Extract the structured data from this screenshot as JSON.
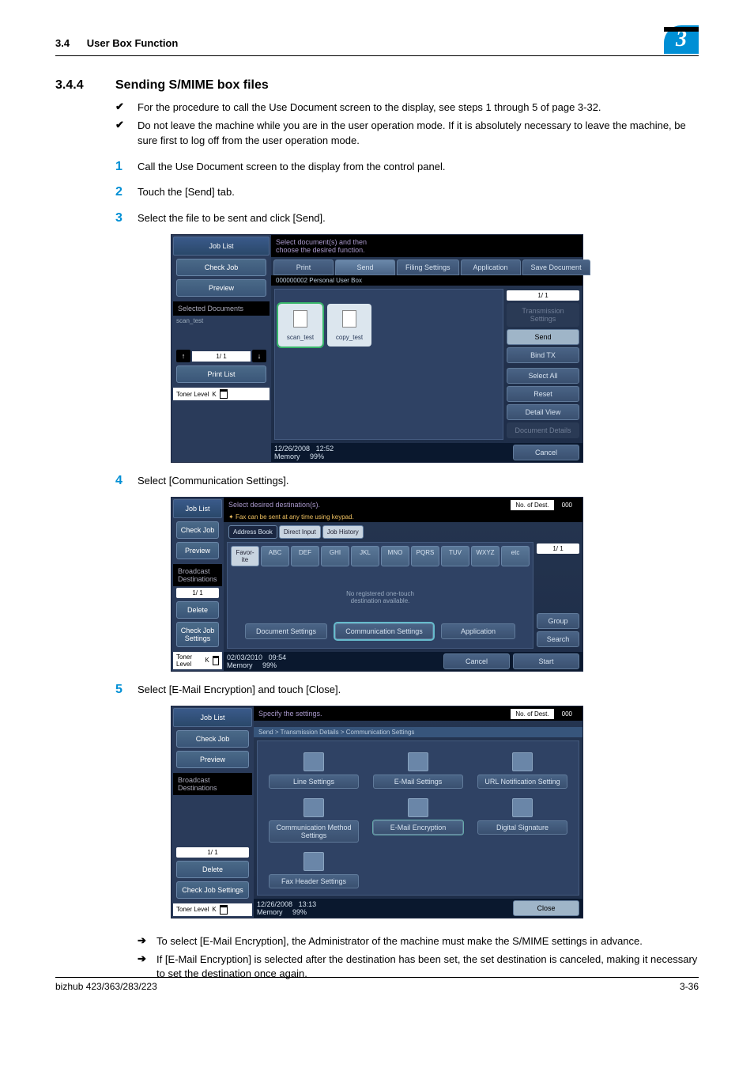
{
  "header": {
    "section": "3.4",
    "title": "User Box Function",
    "badge": "3"
  },
  "heading": {
    "num": "3.4.4",
    "title": "Sending S/MIME box files"
  },
  "bullets": [
    "For the procedure to call the Use Document screen to the display, see steps 1 through 5 of page 3-32.",
    "Do not leave the machine while you are in the user operation mode. If it is absolutely necessary to leave the machine, be sure first to log off from the user operation mode."
  ],
  "steps": {
    "s1": "Call the Use Document screen to the display from the control panel.",
    "s2": "Touch the [Send] tab.",
    "s3": "Select the file to be sent and click [Send].",
    "s4": "Select [Communication Settings].",
    "s5": "Select [E-Mail Encryption] and touch [Close]."
  },
  "arrows": [
    "To select [E-Mail Encryption], the Administrator of the machine must make the S/MIME settings in advance.",
    "If [E-Mail Encryption] is selected after the destination has been set, the set destination is canceled, making it necessary to set the destination once again."
  ],
  "ss_common_left": {
    "job_list": "Job List",
    "check_job": "Check Job",
    "preview": "Preview",
    "broadcast": "Broadcast Destinations",
    "selected_docs": "Selected Documents",
    "scan_test": "scan_test",
    "page": "1/  1",
    "delete": "Delete",
    "check_job_settings": "Check Job Settings",
    "print_list": "Print List",
    "toner": "Toner Level",
    "k": "K"
  },
  "ss1": {
    "instr": "Select document(s) and then\nchoose the desired function.",
    "tabs": {
      "print": "Print",
      "send": "Send",
      "filing": "Filing Settings",
      "application": "Application",
      "save": "Save Document"
    },
    "boxlabel": "000000002  Personal User Box",
    "thumbs": {
      "t1": "scan_test",
      "t2": "copy_test"
    },
    "right": {
      "page": "1/  1",
      "trans": "Transmission Settings",
      "send": "Send",
      "bind": "Bind TX",
      "select": "Select All",
      "reset": "Reset",
      "detail": "Detail View",
      "docdet": "Document Details"
    },
    "cancel": "Cancel",
    "status": {
      "date": "12/26/2008",
      "time": "12:52",
      "mem": "Memory",
      "pct": "99%"
    }
  },
  "ss2": {
    "instr": "Select desired destination(s).",
    "hint": "Fax can be sent at any time using keypad.",
    "chip": {
      "label": "No. of Dest.",
      "val": "000"
    },
    "tabs": {
      "ab": "Address Book",
      "di": "Direct Input",
      "jh": "Job History"
    },
    "keys": {
      "fav": "Favor-ite",
      "abc": "ABC",
      "def": "DEF",
      "ghi": "GHI",
      "jkl": "JKL",
      "mno": "MNO",
      "pqrs": "PQRS",
      "tuv": "TUV",
      "wxyz": "WXYZ",
      "etc": "etc"
    },
    "msg": "No registered one-touch\ndestination available.",
    "right": {
      "page": "1/  1",
      "group": "Group",
      "search": "Search"
    },
    "bottom": {
      "doc": "Document Settings",
      "comm": "Communication Settings",
      "app": "Application",
      "cancel": "Cancel",
      "start": "Start"
    },
    "status": {
      "date": "02/03/2010",
      "time": "09:54",
      "mem": "Memory",
      "pct": "99%"
    }
  },
  "ss3": {
    "instr": "Specify the settings.",
    "chip": {
      "label": "No. of Dest.",
      "val": "000"
    },
    "crumb": "Send > Transmission Details > Communication Settings",
    "grid": {
      "line": "Line Settings",
      "email": "E-Mail Settings",
      "url": "URL Notification Setting",
      "method": "Communication Method Settings",
      "enc": "E-Mail Encryption",
      "sig": "Digital Signature",
      "faxh": "Fax Header Settings"
    },
    "close": "Close",
    "status": {
      "date": "12/26/2008",
      "time": "13:13",
      "mem": "Memory",
      "pct": "99%"
    }
  },
  "footer": {
    "model": "bizhub 423/363/283/223",
    "page": "3-36"
  }
}
